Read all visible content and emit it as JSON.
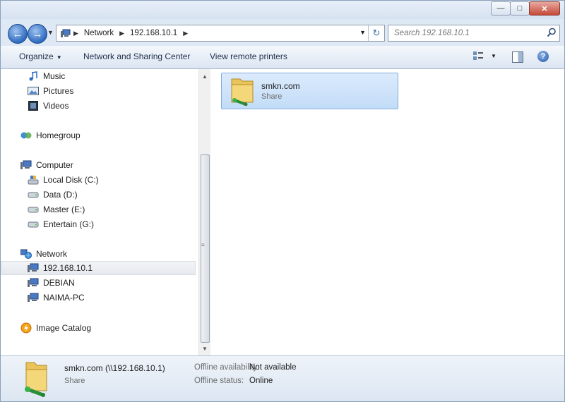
{
  "address": {
    "crumbs": [
      "Network",
      "192.168.10.1"
    ],
    "search_placeholder": "Search 192.168.10.1"
  },
  "command_bar": {
    "organize_label": "Organize",
    "network_sharing_label": "Network and Sharing Center",
    "view_printers_label": "View remote printers"
  },
  "nav_pane": {
    "items": [
      {
        "label": "Music",
        "icon": "music-icon"
      },
      {
        "label": "Pictures",
        "icon": "pictures-icon"
      },
      {
        "label": "Videos",
        "icon": "videos-icon"
      },
      {
        "label": "Homegroup",
        "icon": "homegroup-icon"
      },
      {
        "label": "Computer",
        "icon": "computer-icon"
      },
      {
        "label": "Local Disk (C:)",
        "icon": "local-disk-icon"
      },
      {
        "label": "Data (D:)",
        "icon": "drive-icon"
      },
      {
        "label": "Master (E:)",
        "icon": "drive-icon"
      },
      {
        "label": "Entertain (G:)",
        "icon": "drive-icon"
      },
      {
        "label": "Network",
        "icon": "network-icon"
      },
      {
        "label": "192.168.10.1",
        "icon": "network-computer-icon",
        "selected": true
      },
      {
        "label": "DEBIAN",
        "icon": "network-computer-icon"
      },
      {
        "label": "NAIMA-PC",
        "icon": "network-computer-icon"
      },
      {
        "label": "Image Catalog",
        "icon": "image-catalog-icon"
      }
    ]
  },
  "content": {
    "items": [
      {
        "name": "smkn.com",
        "type": "Share",
        "icon": "shared-folder-icon"
      }
    ]
  },
  "details": {
    "title": "smkn.com (\\\\192.168.10.1)",
    "type": "Share",
    "offline_availability_label": "Offline availability:",
    "offline_availability_value": "Not available",
    "offline_status_label": "Offline status:",
    "offline_status_value": "Online"
  },
  "colors": {
    "accent": "#3074c8",
    "selection": "#cce3f9",
    "window_frame": "#dfe9f5"
  }
}
